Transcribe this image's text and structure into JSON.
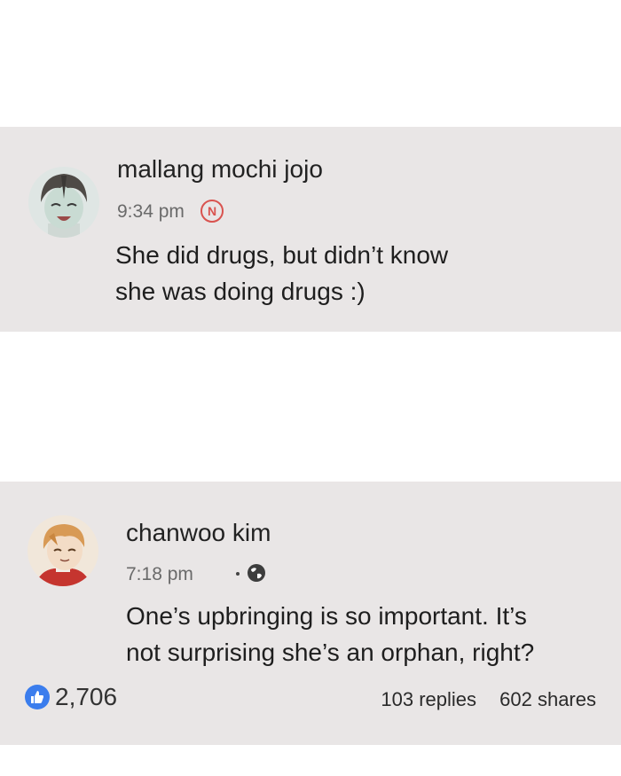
{
  "comments": [
    {
      "author": "mallang mochi jojo",
      "time": "9:34 pm",
      "badge": "N",
      "text_lines": [
        "She did drugs, but didn’t know",
        "she was doing drugs :)"
      ],
      "avatar_icon": "avatar-dark-hair-boy"
    },
    {
      "author": "chanwoo kim",
      "time": "7:18 pm",
      "text_lines": [
        "One’s upbringing is so important. It’s",
        "not surprising she’s an orphan, right?"
      ],
      "avatar_icon": "avatar-orange-hair-boy",
      "likes": "2,706",
      "replies": "103 replies",
      "shares": "602 shares"
    }
  ],
  "colors": {
    "card_bg": "#e9e6e6",
    "badge_red": "#d9534f",
    "like_blue": "#3b7ded"
  }
}
